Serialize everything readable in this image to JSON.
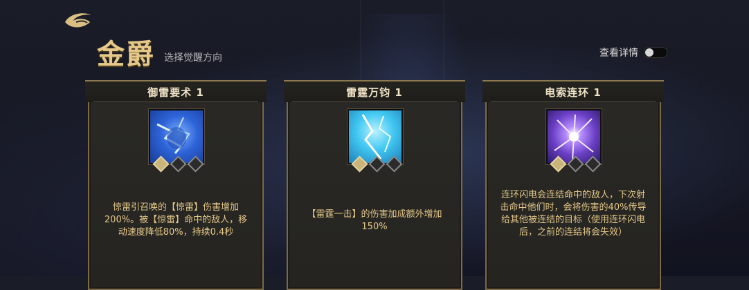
{
  "header": {
    "title": "金爵",
    "subtitle": "选择觉醒方向"
  },
  "toggle": {
    "label": "查看详情",
    "state": "off"
  },
  "cards": [
    {
      "title": "御雷要术 1",
      "icon": "lightning-blue-icon",
      "level": 1,
      "max_level": 3,
      "description": "惊雷引召唤的【惊雷】伤害增加200%。被【惊雷】命中的敌人，移动速度降低80%，持续0.4秒"
    },
    {
      "title": "雷霆万钧 1",
      "icon": "lightning-cyan-icon",
      "level": 1,
      "max_level": 3,
      "description": "【雷霆一击】的伤害加成额外增加150%"
    },
    {
      "title": "电索连环 1",
      "icon": "lightning-purple-icon",
      "level": 1,
      "max_level": 3,
      "description": "连环闪电会连结命中的敌人，下次射击命中他们时，会将伤害的40%传导给其他被连结的目标（使用连环闪电后，之前的连结将会失效）"
    }
  ],
  "colors": {
    "accent_gold": "#e6c98a",
    "card_border": "#7d6a44",
    "background": "#161823"
  }
}
